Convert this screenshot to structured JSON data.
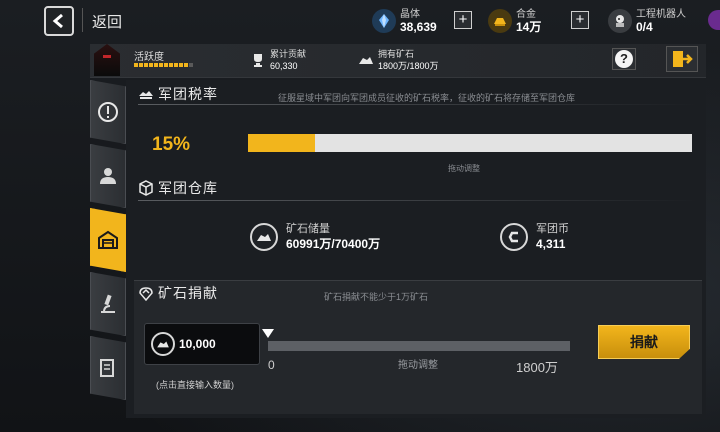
{
  "topbar": {
    "back_label": "返回",
    "resources": [
      {
        "name": "晶体",
        "value": "38,639",
        "icon": "crystal-icon",
        "color": "#6fb6ff"
      },
      {
        "name": "合金",
        "value": "14万",
        "icon": "alloy-icon",
        "color": "#f2b51c"
      },
      {
        "name": "工程机器人",
        "value": "0/4",
        "icon": "robot-icon",
        "color": "#e8e8e8"
      }
    ]
  },
  "status": {
    "activity_label": "活跃度",
    "activity_level": 0.9,
    "contribution_label": "累计贡献",
    "contribution_value": "60,330",
    "ore_label": "拥有矿石",
    "ore_value": "1800万/1800万",
    "help_label": "?"
  },
  "tabs": [
    {
      "icon": "alert-icon",
      "active": false
    },
    {
      "icon": "person-icon",
      "active": false
    },
    {
      "icon": "warehouse-icon",
      "active": true
    },
    {
      "icon": "microscope-icon",
      "active": false
    },
    {
      "icon": "document-icon",
      "active": false
    }
  ],
  "tax": {
    "title": "军团税率",
    "description": "征服星域中军团向军团成员征收的矿石税率，征收的矿石将存储至军团仓库",
    "percent_label": "15%",
    "percent_value": 0.15,
    "drag_hint": "拖动调整"
  },
  "warehouse": {
    "title": "军团仓库",
    "ore_label": "矿石储量",
    "ore_value": "60991万/70400万",
    "coin_label": "军团币",
    "coin_value": "4,311"
  },
  "donate": {
    "title": "矿石捐献",
    "hint": "矿石捐献不能少于1万矿石",
    "input_value": "10,000",
    "input_caption": "(点击直接输入数量)",
    "slider_min": "0",
    "slider_hint": "拖动调整",
    "slider_max": "1800万",
    "button_label": "捐献"
  }
}
